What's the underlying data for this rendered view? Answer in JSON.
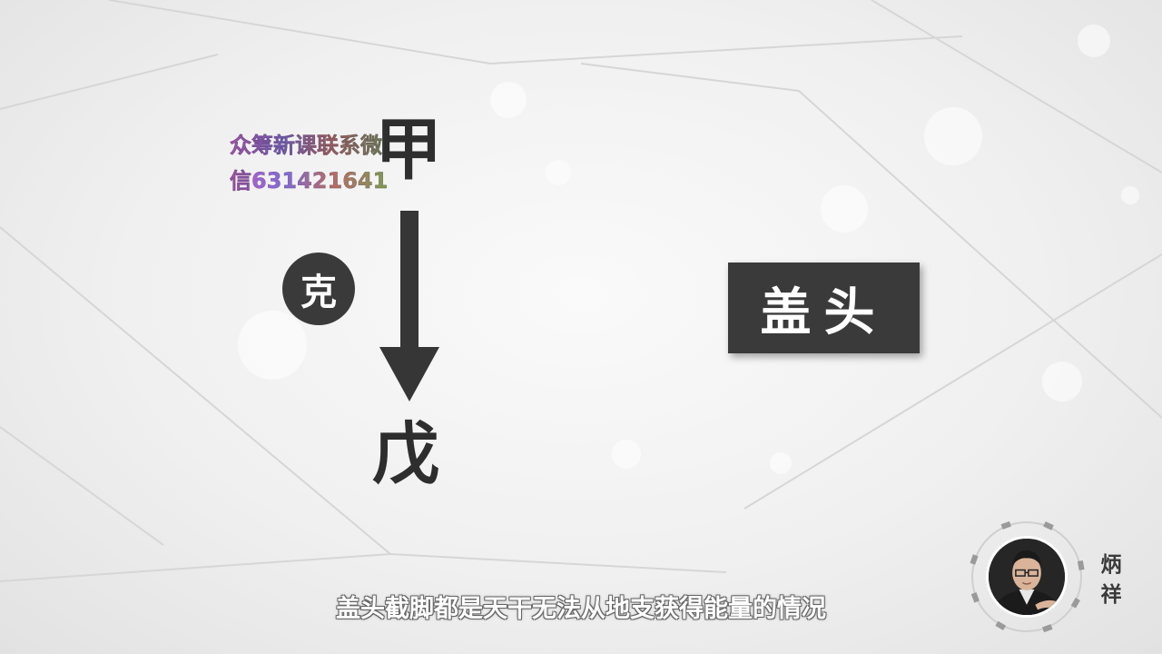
{
  "diagram": {
    "top_char": "甲",
    "bottom_char": "戊",
    "relation_badge": "克",
    "term_box": "盖头"
  },
  "watermark": {
    "line1": "众筹新课联系微",
    "line2": "信631421641"
  },
  "subtitle": "盖头截脚都是天干无法从地支获得能量的情况",
  "presenter": {
    "name": "炳祥"
  },
  "colors": {
    "dark": "#3a3a3a",
    "background": "#f0f0f0"
  }
}
